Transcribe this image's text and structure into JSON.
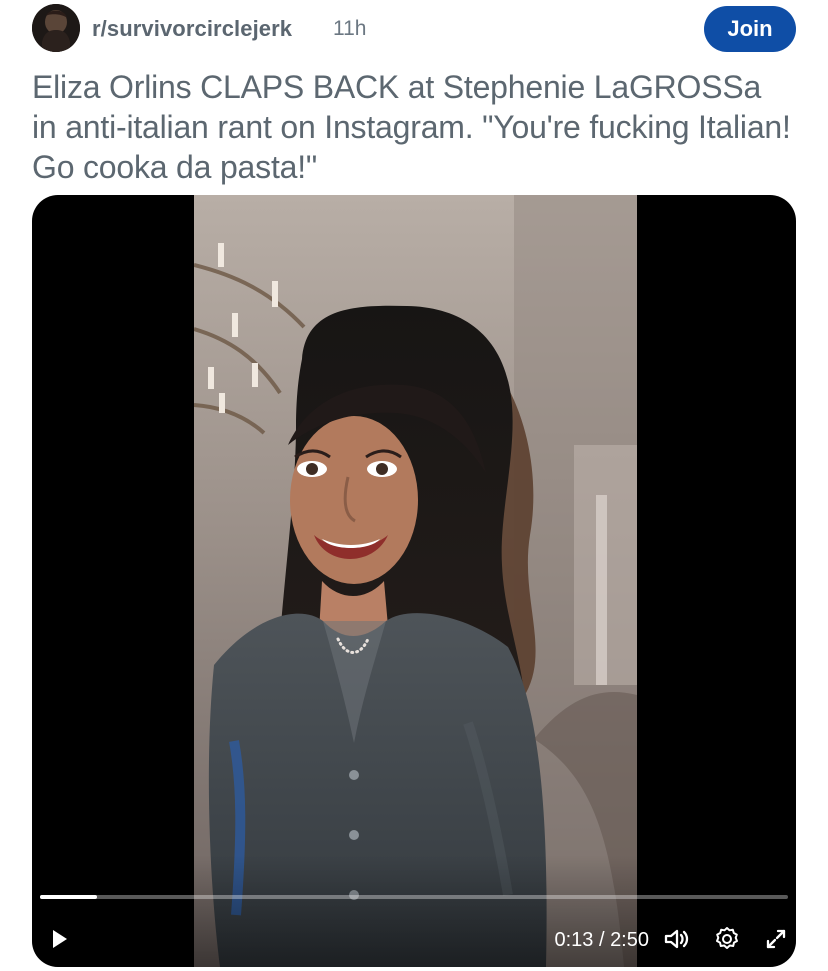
{
  "post": {
    "subreddit": "r/survivorcirclejerk",
    "age": "11h",
    "join_label": "Join",
    "title": "Eliza Orlins CLAPS BACK at Stephenie LaGROSSa in anti-italian rant on Instagram. \"You're fucking Italian! Go cooka da pasta!\""
  },
  "video": {
    "current_time": "0:13",
    "separator": " / ",
    "duration": "2:50",
    "progress_fraction": 0.076
  },
  "icons": {
    "avatar": "avatar-icon",
    "play": "play-icon",
    "volume": "volume-icon",
    "settings": "gear-icon",
    "fullscreen": "expand-icon"
  },
  "colors": {
    "join_background": "#0f4ea6",
    "title_text": "#5c6770",
    "video_background": "#000000"
  }
}
